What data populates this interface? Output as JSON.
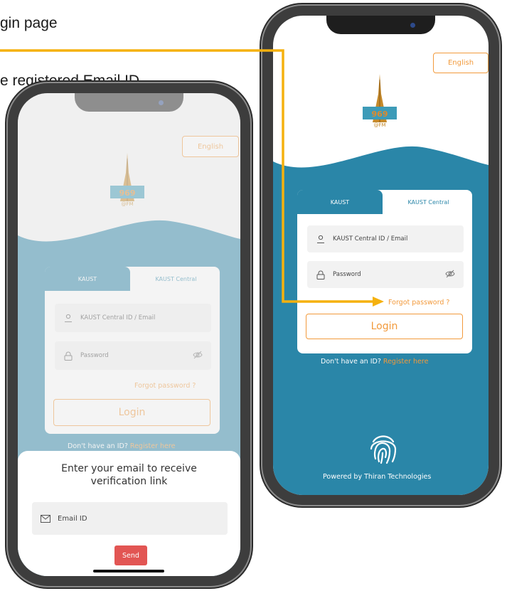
{
  "captions": {
    "line1": "gin page",
    "line2": "e registered Email ID"
  },
  "app": {
    "language_button": "English",
    "logo_text": "@FM",
    "tabs": [
      "KAUST",
      "KAUST Central"
    ],
    "id_placeholder": "KAUST Central ID / Email",
    "password_placeholder": "Password",
    "forgot_password": "Forgot password ?",
    "login_button": "Login",
    "no_id_text": "Don't have an ID?",
    "register_link": "Register here",
    "powered_by": "Powered by Thiran Technologies"
  },
  "sheet": {
    "title": "Enter your email to receive verification link",
    "email_placeholder": "Email ID",
    "send_button": "Send"
  },
  "colors": {
    "accent": "#f29a3c",
    "teal": "#2a86a8",
    "send": "#e25553",
    "arrow": "#f5b10e"
  },
  "icons": [
    "user-icon",
    "lock-icon",
    "eye-off-icon",
    "fingerprint-icon",
    "mail-icon",
    "tower-logo-icon"
  ]
}
